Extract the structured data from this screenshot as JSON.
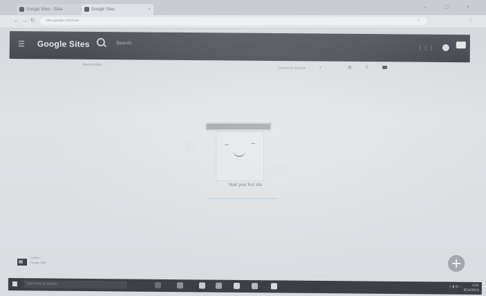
{
  "browser": {
    "tabs": [
      {
        "label": "Google Sites - Sites"
      },
      {
        "label": "Google Sites"
      }
    ],
    "omnibox": {
      "url": "sites.google.com/new"
    }
  },
  "header": {
    "title": "Google Sites",
    "search_placeholder": "Search"
  },
  "subheader": {
    "recent_label": "Recent sites",
    "owner_filter": "Owned by anyone",
    "owner_caret": "▾"
  },
  "empty_state": {
    "message": "Start your first site"
  },
  "bottom_site": {
    "name": "Untitled",
    "meta": "Google Sites"
  },
  "icons": {
    "hamburger": "☰",
    "apps": "⋮⋮⋮",
    "grid_view": "▦",
    "sort": "⇅",
    "back": "←",
    "forward": "→",
    "reload": "↻",
    "star": "☆",
    "menu": "⋮",
    "window_controls": "– ▢ ×",
    "tab_close": "×"
  },
  "taskbar": {
    "search_placeholder": "Type here to search",
    "tray": "∧  ▮  ◍  ♪",
    "time": "4:31",
    "date": "8/14/2019"
  },
  "colors": {
    "header_bg": "#4d5157",
    "taskbar_bg": "#3c4045",
    "page_bg": "#dcdfe2",
    "fab": "#a6a9ae"
  }
}
